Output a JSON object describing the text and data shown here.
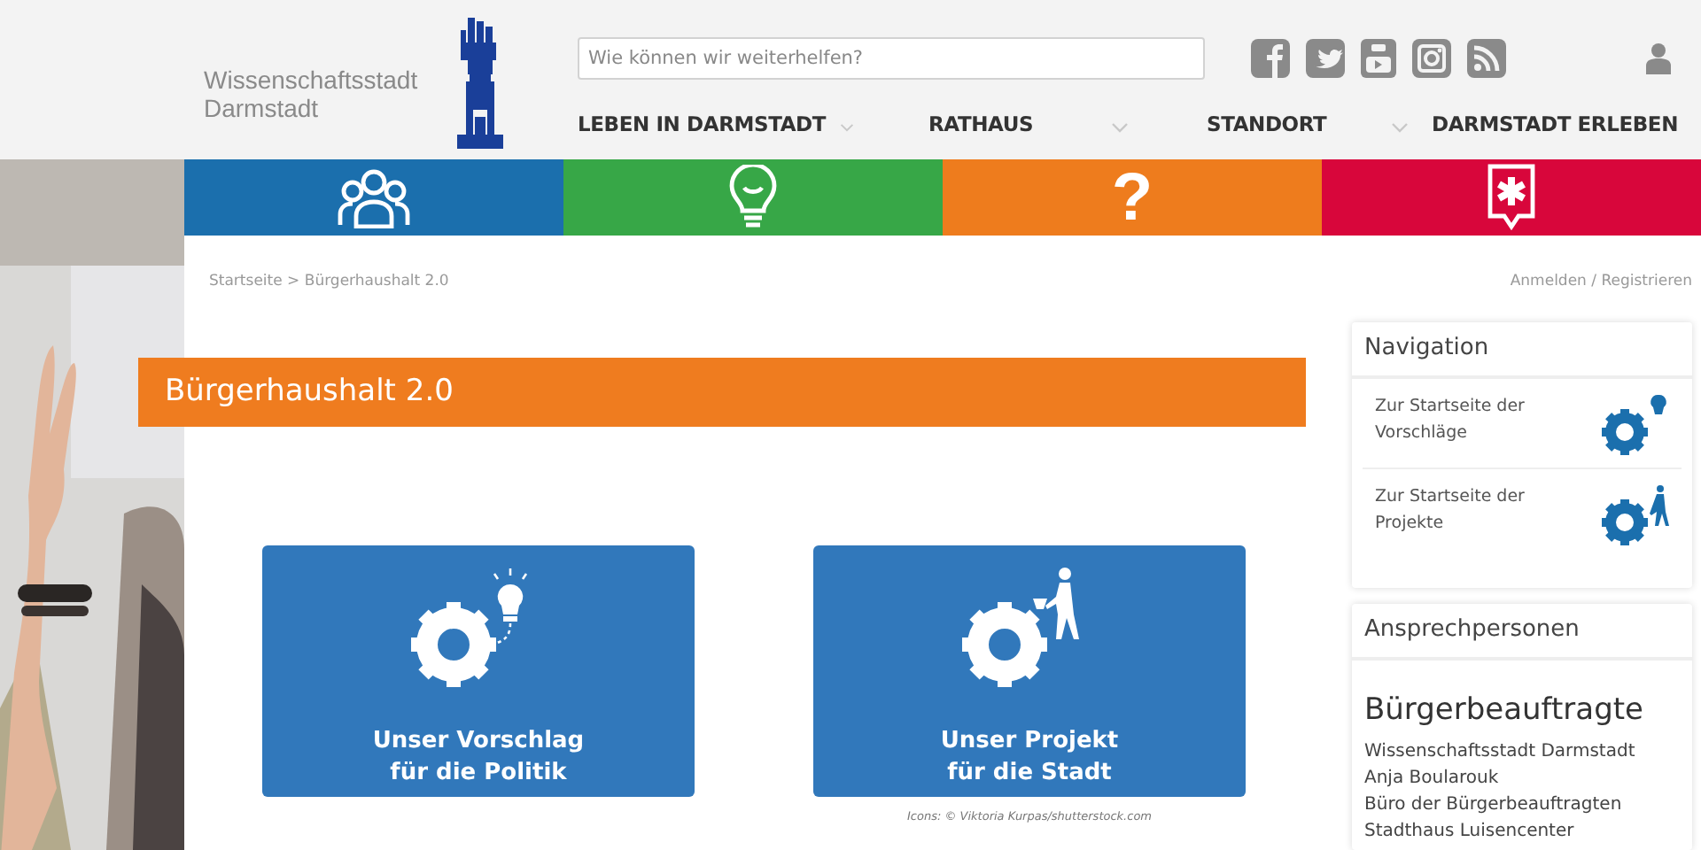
{
  "header": {
    "logo_lines": [
      "Wissenschaftsstadt",
      "Darmstadt"
    ],
    "search": {
      "placeholder": "Wie können wir weiterhelfen?"
    },
    "social_icons": [
      {
        "kind": "facebook"
      },
      {
        "kind": "twitter"
      },
      {
        "kind": "youtube"
      },
      {
        "kind": "instagram"
      },
      {
        "kind": "rss"
      }
    ],
    "menu": [
      {
        "label": "LEBEN IN DARMSTADT"
      },
      {
        "label": "RATHAUS"
      },
      {
        "label": "STANDORT"
      },
      {
        "label": "DARMSTADT ERLEBEN"
      }
    ]
  },
  "tiles": [
    {
      "kind": "people",
      "color": "#1b6fad"
    },
    {
      "kind": "bulb",
      "color": "#37a747"
    },
    {
      "kind": "glyph",
      "glyph": "?",
      "color": "#ee7c1d"
    },
    {
      "kind": "star",
      "color": "#d8063b"
    }
  ],
  "breadcrumb": "Startseite > Bürgerhaushalt 2.0",
  "auth": "Anmelden / Registrieren",
  "title": "Bürgerhaushalt 2.0",
  "cards": [
    {
      "kind": "idea",
      "lines": [
        "Unser Vorschlag",
        "für die Politik"
      ]
    },
    {
      "kind": "project",
      "lines": [
        "Unser Projekt",
        "für die Stadt"
      ]
    }
  ],
  "credit": "Icons: © Viktoria Kurpas/shutterstock.com",
  "sidebar": {
    "navigation": {
      "title": "Navigation",
      "links": [
        {
          "kind": "idea",
          "label": "Zur Startseite der Vorschläge"
        },
        {
          "kind": "project",
          "label": "Zur Startseite der Projekte"
        }
      ]
    },
    "contacts": {
      "title": "Ansprechpersonen",
      "heading": "Bürgerbeauftragte",
      "lines": [
        "Wissenschaftsstadt Darmstadt",
        "Anja Boularouk",
        "Büro der Bürgerbeauftragten",
        "Stadthaus Luisencenter"
      ]
    }
  }
}
